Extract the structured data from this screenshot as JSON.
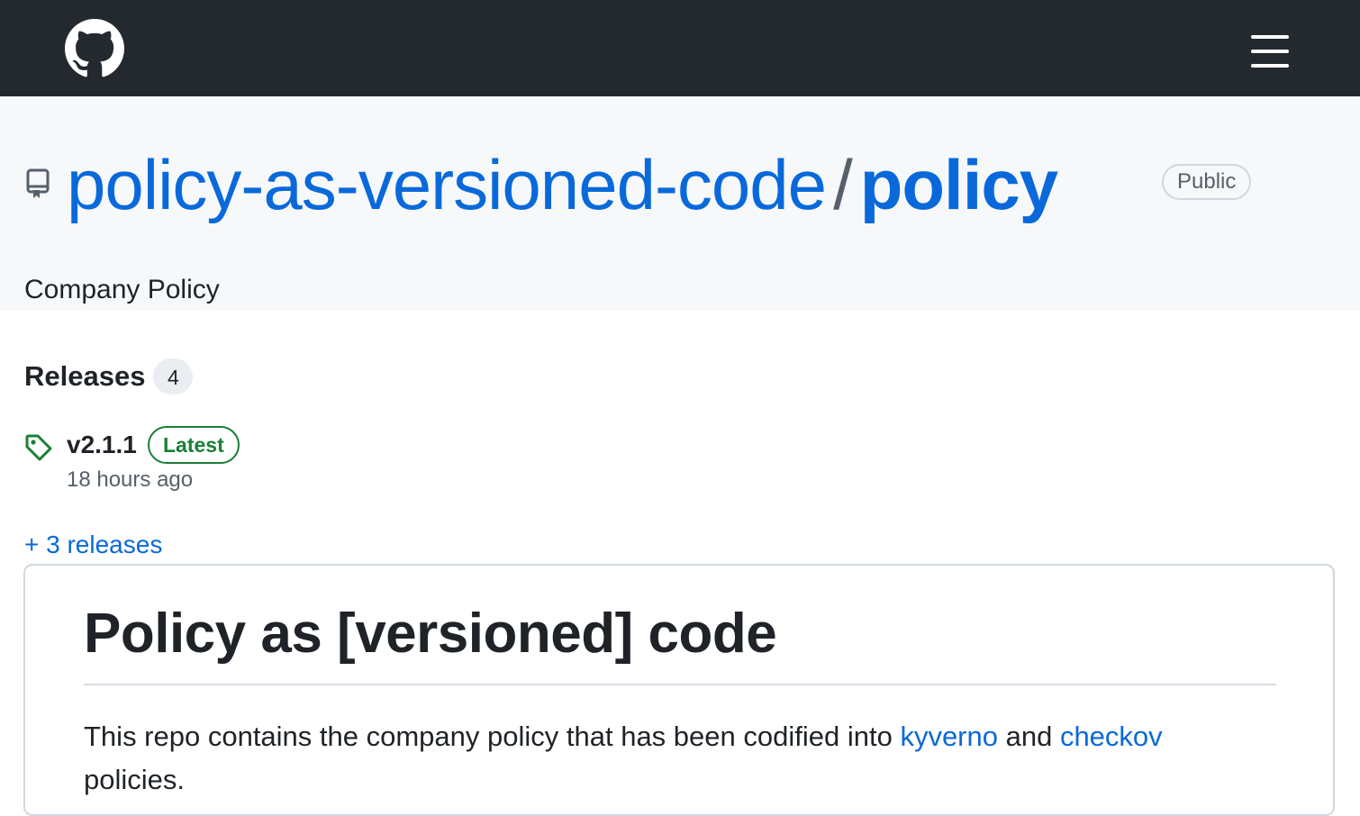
{
  "header": {
    "logo_icon": "github-mark-icon",
    "menu_icon": "hamburger-menu-icon",
    "background": "#24292f"
  },
  "repo": {
    "owner": "policy-as-versioned-code",
    "separator": "/",
    "name": "policy",
    "visibility": "Public",
    "description": "Company Policy",
    "icon": "repo-icon"
  },
  "releases": {
    "title": "Releases",
    "count": "4",
    "latest": {
      "icon": "tag-icon",
      "version": "v2.1.1",
      "badge": "Latest",
      "time": "18 hours ago"
    },
    "more_link": "+ 3 releases"
  },
  "readme": {
    "heading": "Policy as [versioned] code",
    "paragraph": {
      "text_before": "This repo contains the company policy that has been codified into ",
      "link1": "kyverno",
      "text_middle": " and ",
      "link2": "checkov",
      "text_after": " policies."
    }
  },
  "colors": {
    "link": "#0969da",
    "latest_green": "#1a7f37",
    "muted": "#57606a"
  }
}
